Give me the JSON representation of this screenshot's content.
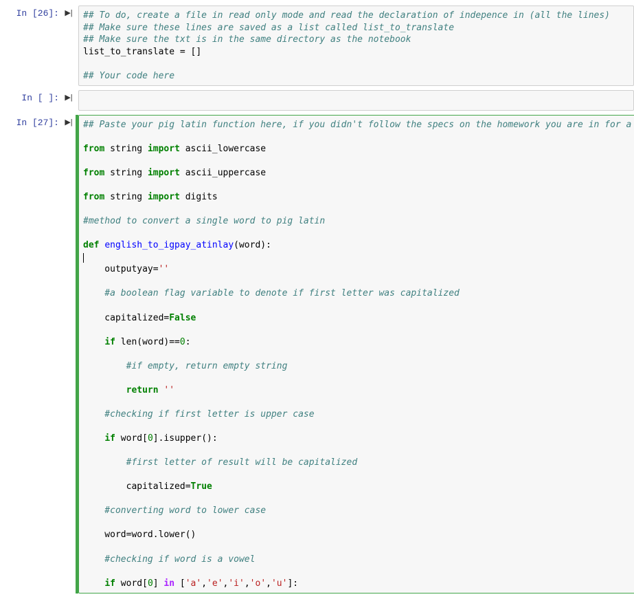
{
  "cells": {
    "c26": {
      "prompt": "In [26]:",
      "l1": "## To do, create a file in read only mode and read the declaration of indepence in (all the lines)",
      "l2": "## Make sure these lines are saved as a list called list_to_translate",
      "l3": "## Make sure the txt is in the same directory as the notebook",
      "l4": "list_to_translate = []",
      "l5": "## Your code here"
    },
    "empty": {
      "prompt": "In [ ]:"
    },
    "c27": {
      "prompt": "In [27]:",
      "l1": "## Paste your pig latin function here, if you didn't follow the specs on the homework you are in for a rough time",
      "kw_from": "from",
      "kw_import": "import",
      "kw_def": "def",
      "kw_if": "if",
      "kw_return": "return",
      "kw_in": "in",
      "mod_string": " string ",
      "imp_lower": " ascii_lowercase",
      "imp_upper": " ascii_uppercase",
      "imp_digits": " digits",
      "c_method": "#method to convert a single word to pig latin",
      "fn_name": "english_to_igpay_atinlay",
      "fn_args": "(word):",
      "out_var": "    outputyay=",
      "out_str": "''",
      "c_flag": "    #a boolean flag variable to denote if first letter was capitalized",
      "cap_var": "    capitalized=",
      "false_kw": "False",
      "if_len1": " len(word)==",
      "zero": "0",
      "colon": ":",
      "c_empty": "        #if empty, return empty string",
      "ret_pad": "        ",
      "ret_str": " ''",
      "c_upper": "    #checking if first letter is upper case",
      "if_word0": " word[",
      "idx0": "0",
      "isupper": "].isupper():",
      "c_first": "        #first letter of result will be capitalized",
      "cap_pad": "        capitalized=",
      "true_kw": "True",
      "c_lower": "    #converting word to lower case",
      "word_lower": "    word=word.lower()",
      "c_vowel": "    #checking if word is a vowel",
      "if_word0b": " word[",
      "bracket_close": "] ",
      "vowels": " ['a','e','i','o','u']:",
      "va": "'a'",
      "ve": "'e'",
      "vi": "'i'",
      "vo": "'o'",
      "vu": "'u'",
      "comma": ","
    }
  }
}
